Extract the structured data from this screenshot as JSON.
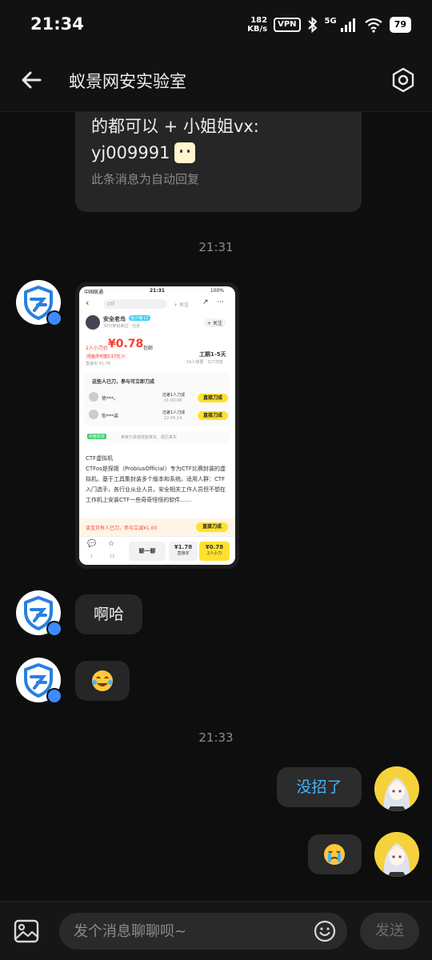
{
  "status_bar": {
    "time": "21:34",
    "net_speed_value": "182",
    "net_speed_unit": "KB/s",
    "vpn": "VPN",
    "network": "5G",
    "battery": "79"
  },
  "header": {
    "title": "蚁景网安实验室"
  },
  "messages": {
    "top_bubble_line1": "的都可以 + 小姐姐vx:",
    "top_bubble_line2": "yj009991",
    "top_bubble_note": "此条消息为自动回复",
    "time1": "21:31",
    "msg_aha": "啊哈",
    "time2": "21:33",
    "msg_no_move": "没招了"
  },
  "screenshot": {
    "status_carrier": "中国联通",
    "status_time": "21:31",
    "status_battery": "100%",
    "search": "ctf",
    "follow_top": "+ 关注",
    "seller_name": "安全老鸟",
    "seller_badge": "信小铺 L2",
    "seller_meta": "30分钟前来过 · 北京",
    "follow": "+ 关注",
    "price_label": "2人小刀价",
    "price": "¥0.78",
    "price_note": "包邮",
    "buy_direct": "直接买 ¥1.78",
    "idle_coin": "闲鱼币可抵0.17元 >",
    "workday": "工期1-5天",
    "stats": "16人想要 · 317浏览",
    "cut_title": "这些人已刀，参与可立即刀成",
    "cut_user1": "徐***。",
    "cut_user1_status": "还差1人刀成",
    "cut_user1_time": "01:00:08",
    "cut_user2": "你***弟",
    "cut_user2_status": "还差1人刀成",
    "cut_user2_time": "12:45:14",
    "cut_btn": "直接刀成",
    "cut_tag": "正在抢购",
    "verify_tag": "闲鱼验货",
    "verify_text": "卖家已承诺技能真实、经历真实",
    "desc_title": "CTF虚拟机",
    "desc_body": "CTFos是探姬（ProbiusOfficial）专为CTF比赛封装的虚拟机。基于工具集封装多个版本和系统。适用人群：CTF入门选手，各行业从业人员，安全相关工作人员但不想在工作机上安装CTF一些奇奇怪怪的软件……",
    "orange_bar_text": "该宝贝有人已刀，参与立减¥1.00",
    "orange_bar_btn": "直接刀成",
    "chat_btn": "聊一聊",
    "buy_price": "¥1.78",
    "buy_label": "直接买",
    "cut_price": "¥0.78",
    "cut_label": "2人小刀",
    "count1": "1",
    "count2": "12"
  },
  "composer": {
    "placeholder": "发个消息聊聊呗~",
    "send": "发送"
  },
  "icons": {
    "back": "arrow-left-icon",
    "settings": "hexagon-gear-icon",
    "image": "image-icon",
    "emoji": "smile-icon"
  },
  "colors": {
    "accent_blue": "#43b5ff",
    "bubble_dark": "#262626",
    "avatar_yellow": "#f5d23b"
  }
}
